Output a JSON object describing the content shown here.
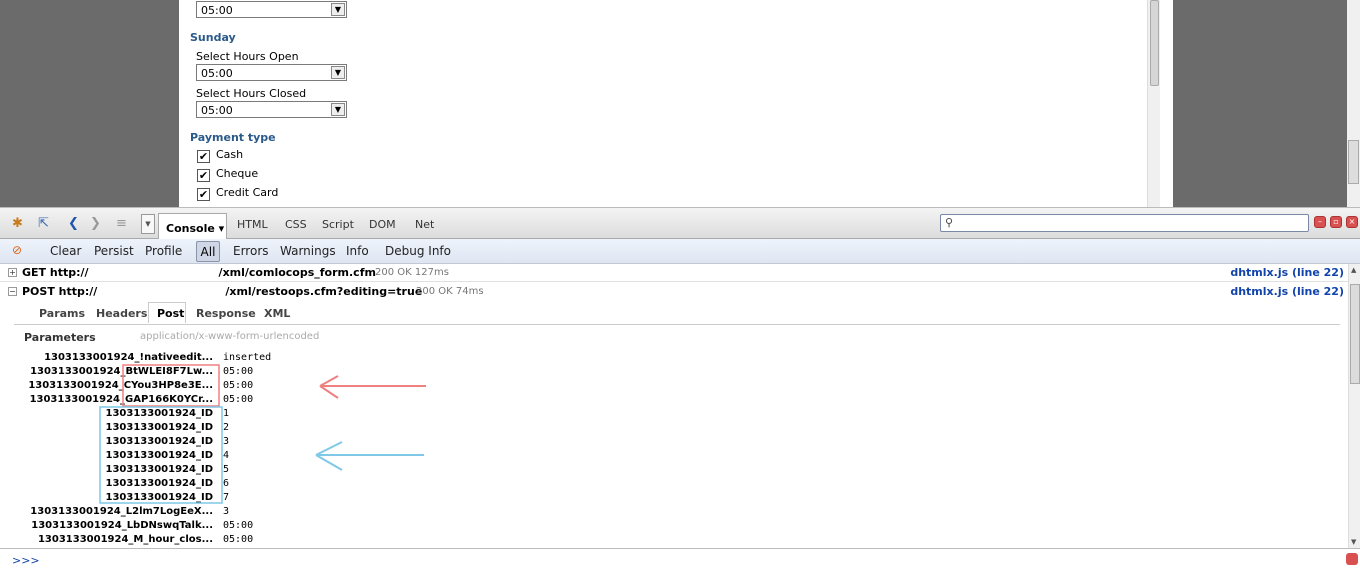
{
  "webpage": {
    "top_select_value": "05:00",
    "sunday": {
      "heading": "Sunday",
      "open_label": "Select Hours Open",
      "open_value": "05:00",
      "closed_label": "Select Hours Closed",
      "closed_value": "05:00"
    },
    "payment": {
      "heading": "Payment type",
      "options": [
        {
          "label": "Cash",
          "checked": true
        },
        {
          "label": "Cheque",
          "checked": true
        },
        {
          "label": "Credit Card",
          "checked": true
        }
      ]
    }
  },
  "firebug": {
    "tabs": {
      "console": "Console",
      "html": "HTML",
      "css": "CSS",
      "script": "Script",
      "dom": "DOM",
      "net": "Net"
    },
    "console_toolbar": {
      "clear": "Clear",
      "persist": "Persist",
      "profile": "Profile",
      "all": "All",
      "errors": "Errors",
      "warnings": "Warnings",
      "info": "Info",
      "debug_info": "Debug Info"
    },
    "requests": [
      {
        "method_url": "GET http://",
        "url_tail": "/xml/comlocops_form.cfm",
        "status": "200 OK 127ms",
        "source": "dhtmlx.js (line 22)"
      },
      {
        "method_url": "POST http://",
        "url_tail": "/xml/restoops.cfm?editing=true",
        "status": "200 OK 74ms",
        "source": "dhtmlx.js (line 22)"
      }
    ],
    "subtabs": {
      "params": "Params",
      "headers": "Headers",
      "post": "Post",
      "response": "Response",
      "xml": "XML"
    },
    "params_title": "Parameters",
    "content_type": "application/x-www-form-urlencoded",
    "params": [
      {
        "name": "1303133001924_!nativeedit...",
        "value": "inserted"
      },
      {
        "name": "1303133001924_BtWLEI8F7Lw...",
        "value": "05:00"
      },
      {
        "name": "1303133001924_CYou3HP8e3E...",
        "value": "05:00"
      },
      {
        "name": "1303133001924_GAP166K0YCr...",
        "value": "05:00"
      },
      {
        "name": "1303133001924_ID",
        "value": "1"
      },
      {
        "name": "1303133001924_ID",
        "value": "2"
      },
      {
        "name": "1303133001924_ID",
        "value": "3"
      },
      {
        "name": "1303133001924_ID",
        "value": "4"
      },
      {
        "name": "1303133001924_ID",
        "value": "5"
      },
      {
        "name": "1303133001924_ID",
        "value": "6"
      },
      {
        "name": "1303133001924_ID",
        "value": "7"
      },
      {
        "name": "1303133001924_L2lm7LogEeX...",
        "value": "3"
      },
      {
        "name": "1303133001924_LbDNswqTalk...",
        "value": "05:00"
      },
      {
        "name": "1303133001924_M_hour_clos...",
        "value": "05:00"
      }
    ],
    "command_prompt": ">>>",
    "colors": {
      "annotation_red": "#f08080",
      "annotation_blue": "#7fc8e8",
      "link_blue": "#1144aa"
    }
  }
}
